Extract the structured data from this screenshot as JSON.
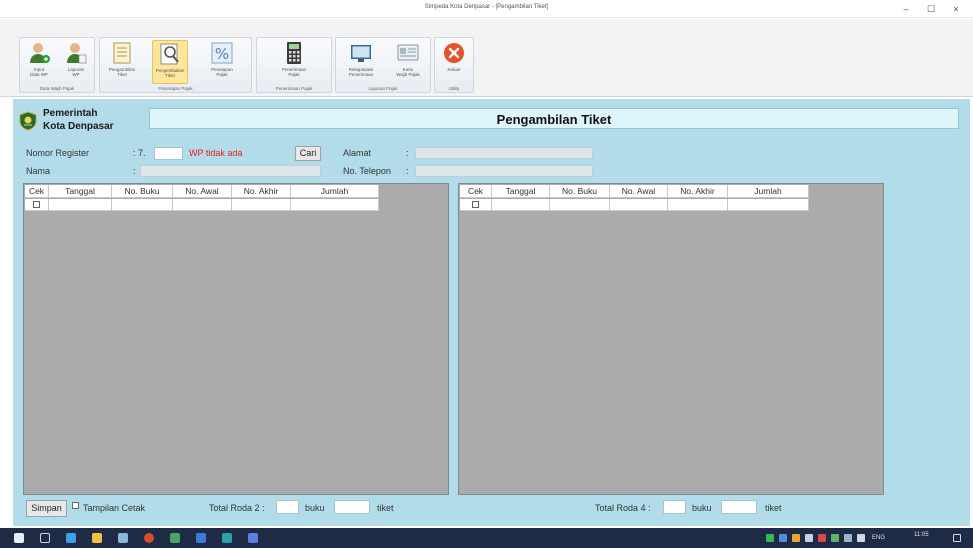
{
  "window": {
    "title": "Simpeda Kota Denpasar - [Pengambilan Tiket]",
    "min": "–",
    "max": "☐",
    "close": "×"
  },
  "ribbon": {
    "groups": [
      {
        "label": "Data Wajib Pajak",
        "buttons": [
          {
            "label": "Input\nData WP"
          },
          {
            "label": "Laporan\nWP"
          }
        ]
      },
      {
        "label": "Penetapan Pajak",
        "buttons": [
          {
            "label": "Pengambilan\nTiket"
          },
          {
            "label": "Pengembalian\nTiket"
          },
          {
            "label": "Penetapan\nPajak"
          }
        ]
      },
      {
        "label": "Penerimaan Pajak",
        "buttons": [
          {
            "label": "Penerimaan\nPajak"
          }
        ]
      },
      {
        "label": "Laporan Pajak",
        "buttons": [
          {
            "label": "Rekapitulasi\nPenerimaan"
          },
          {
            "label": "Kartu\nWajib Pajak"
          }
        ]
      },
      {
        "label": "Utility",
        "buttons": [
          {
            "label": "Keluar"
          }
        ]
      }
    ]
  },
  "header": {
    "org_line1": "Pemerintah",
    "org_line2": "Kota Denpasar",
    "page_title": "Pengambilan Tiket"
  },
  "form": {
    "nomor_register_label": "Nomor Register",
    "nomor_register_colon": ": 7.",
    "nomor_register_value": "",
    "wp_status": "WP tidak ada",
    "cari_label": "Cari",
    "nama_label": "Nama",
    "alamat_label": "Alamat",
    "telepon_label": "No. Telepon",
    "colon": ":"
  },
  "grid_left": {
    "columns": [
      "Cek",
      "Tanggal",
      "No. Buku",
      "No. Awal",
      "No. Akhir",
      "Jumlah"
    ]
  },
  "grid_right": {
    "columns": [
      "Cek",
      "Tanggal",
      "No. Buku",
      "No. Awal",
      "No. Akhir",
      "Jumlah"
    ]
  },
  "footer": {
    "simpan_label": "Simpan",
    "tampilan_cetak_label": "Tampilan Cetak",
    "total_roda2_label": "Total Roda 2 :",
    "total_roda4_label": "Total Roda 4 :",
    "buku_label": "buku",
    "tiket_label": "tiket"
  },
  "taskbar": {
    "lang": "ENG",
    "time": "11:05"
  },
  "colors": {
    "main_bg": "#b3dcea",
    "grid_bg": "#ababab",
    "warning": "#e02020",
    "taskbar": "#1f2a44"
  }
}
